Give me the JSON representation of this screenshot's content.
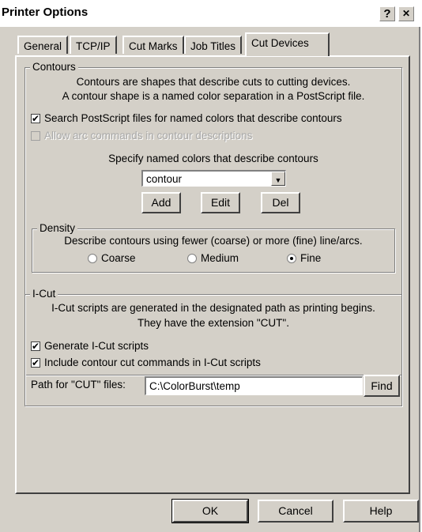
{
  "window": {
    "title": "Printer Options",
    "help_btn": "?",
    "close_btn": "✕"
  },
  "tabs": [
    {
      "label": "General"
    },
    {
      "label": "TCP/IP"
    },
    {
      "label": "Cut Marks"
    },
    {
      "label": "Job Titles"
    },
    {
      "label": "Cut Devices",
      "active": true
    }
  ],
  "contours": {
    "legend": "Contours",
    "desc1": "Contours are shapes that describe cuts to cutting devices.",
    "desc2": "A contour shape is a named color separation in a PostScript file.",
    "search_label": "Search PostScript files for named colors that describe contours",
    "search_checked": true,
    "arc_label": "Allow arc commands in contour descriptions",
    "arc_checked": false,
    "specify_label": "Specify named colors that describe contours",
    "named_color_value": "contour",
    "add_label": "Add",
    "edit_label": "Edit",
    "del_label": "Del"
  },
  "density": {
    "legend": "Density",
    "desc": "Describe contours using fewer (coarse) or more (fine) line/arcs.",
    "options": [
      "Coarse",
      "Medium",
      "Fine"
    ],
    "selected": "Fine"
  },
  "icut": {
    "legend": "I-Cut",
    "desc1": "I-Cut scripts are generated in the designated path as printing begins.",
    "desc2": "They have the extension \"CUT\".",
    "generate_label": "Generate I-Cut scripts",
    "generate_checked": true,
    "include_label": "Include contour cut commands in I-Cut scripts",
    "include_checked": true,
    "path_label": "Path for \"CUT\" files:",
    "path_value": "C:\\ColorBurst\\temp",
    "find_label": "Find"
  },
  "footer": {
    "ok_label": "OK",
    "cancel_label": "Cancel",
    "help_label": "Help"
  }
}
